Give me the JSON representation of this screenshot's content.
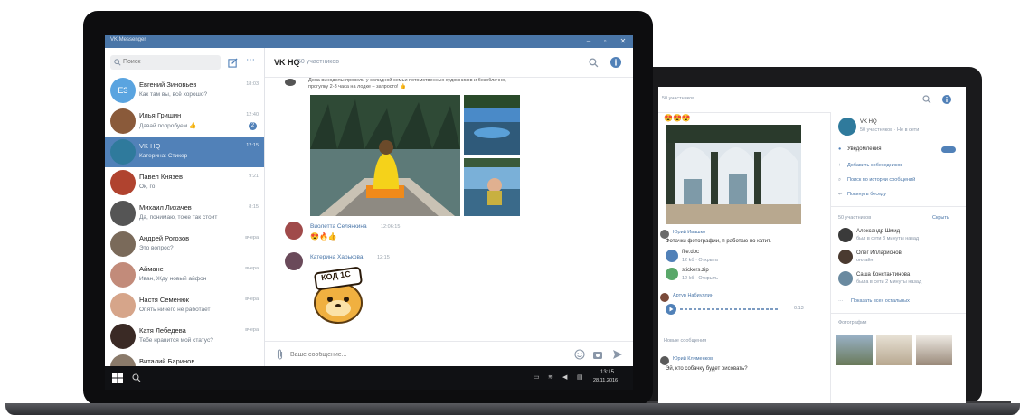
{
  "window": {
    "title": "VK Messenger",
    "minimize": "–",
    "maximize": "▫",
    "close": "✕"
  },
  "sidebar": {
    "search_placeholder": "Поиск",
    "dialogs": [
      {
        "name": "Евгений Зиновьев",
        "preview": "Как там вы, всё хорошо?",
        "time": "18:03",
        "initials": "ЕЗ",
        "avatar_color": "#5aa4e0",
        "active": false,
        "badge": ""
      },
      {
        "name": "Илья Гришин",
        "preview": "Давай попробуем 👍",
        "time": "12:40",
        "initials": "",
        "avatar_color": "#8a5a3a",
        "active": false,
        "badge": "2"
      },
      {
        "name": "VK HQ",
        "preview": "Катерина: Стикер",
        "time": "12:15",
        "initials": "",
        "avatar_color": "#2f7a9c",
        "active": true,
        "badge": ""
      },
      {
        "name": "Павел Князев",
        "preview": "Ок, го",
        "time": "9:21",
        "initials": "",
        "avatar_color": "#b0432f",
        "active": false,
        "badge": ""
      },
      {
        "name": "Михаил Лихачев",
        "preview": "Да, понимаю, тоже так стоит",
        "time": "8:15",
        "initials": "",
        "avatar_color": "#555555",
        "active": false,
        "badge": ""
      },
      {
        "name": "Андрей Рогозов",
        "preview": "Это вопрос?",
        "time": "вчера",
        "initials": "",
        "avatar_color": "#7a6a5a",
        "active": false,
        "badge": ""
      },
      {
        "name": "Аймане",
        "preview": "Иван, Жду новый айфон",
        "time": "вчера",
        "initials": "",
        "avatar_color": "#c28b7a",
        "active": false,
        "badge": ""
      },
      {
        "name": "Настя Семенюк",
        "preview": "Опять ничего не работает",
        "time": "вчера",
        "initials": "",
        "avatar_color": "#d6a58a",
        "active": false,
        "badge": ""
      },
      {
        "name": "Катя Лебедева",
        "preview": "Тебе нравится мой статус?",
        "time": "вчера",
        "initials": "",
        "avatar_color": "#3a2a25",
        "active": false,
        "badge": ""
      },
      {
        "name": "Виталий Баринов",
        "preview": "",
        "time": "",
        "initials": "",
        "avatar_color": "#8a7a6a",
        "active": false,
        "badge": ""
      }
    ]
  },
  "chat": {
    "title": "VK HQ",
    "subtitle": "50 участников",
    "top_message": "Дела виноделы провели у солидной семьи потомственных художников и безоблачно, прогулку 2-3 часа на лодке – запросто! 👍",
    "messages": [
      {
        "author": "Виолетта Селянкина",
        "time": "12:06:15",
        "text": "😍🔥👍"
      },
      {
        "author": "Катерина Харькова",
        "time": "12:15",
        "text": ""
      }
    ],
    "sticker_text": "КОД 1С",
    "composer_placeholder": "Ваше сообщение..."
  },
  "taskbar": {
    "time": "13:15",
    "date": "28.11.2016"
  },
  "tablet": {
    "header_subtitle": "50 участников",
    "top_emoji": "😍😍😍",
    "message1_author": "Юрий Ивашко",
    "message1_text": "Фотачки фотографии, я работаю по катит.",
    "files": [
      {
        "name": "file.doc",
        "meta": "12 kб · Открыть"
      },
      {
        "name": "stickers.zip",
        "meta": "12 kб · Открыть"
      }
    ],
    "voice_author": "Артур Набиуллин",
    "voice_time": "0:13",
    "history_label": "Новые сообщения",
    "last_author": "Юрий Клименков",
    "last_text": "Эй, кто собачку будет рисовать?",
    "panel": {
      "title": "VK HQ",
      "subtitle": "50 участников · Не в сети",
      "actions": [
        "Уведомления",
        "Добавить собеседников",
        "Поиск по истории сообщений",
        "Покинуть беседу"
      ],
      "members_label": "50 участников",
      "members_action": "Скрыть",
      "members": [
        {
          "name": "Александр Шмид",
          "status": "был в сети 3 минуты назад"
        },
        {
          "name": "Олег Илларионов",
          "status": "онлайн"
        },
        {
          "name": "Саша Константинова",
          "status": "была в сети 2 минуты назад"
        }
      ],
      "show_all": "Показать всех остальных",
      "photos_label": "Фотографии"
    }
  }
}
